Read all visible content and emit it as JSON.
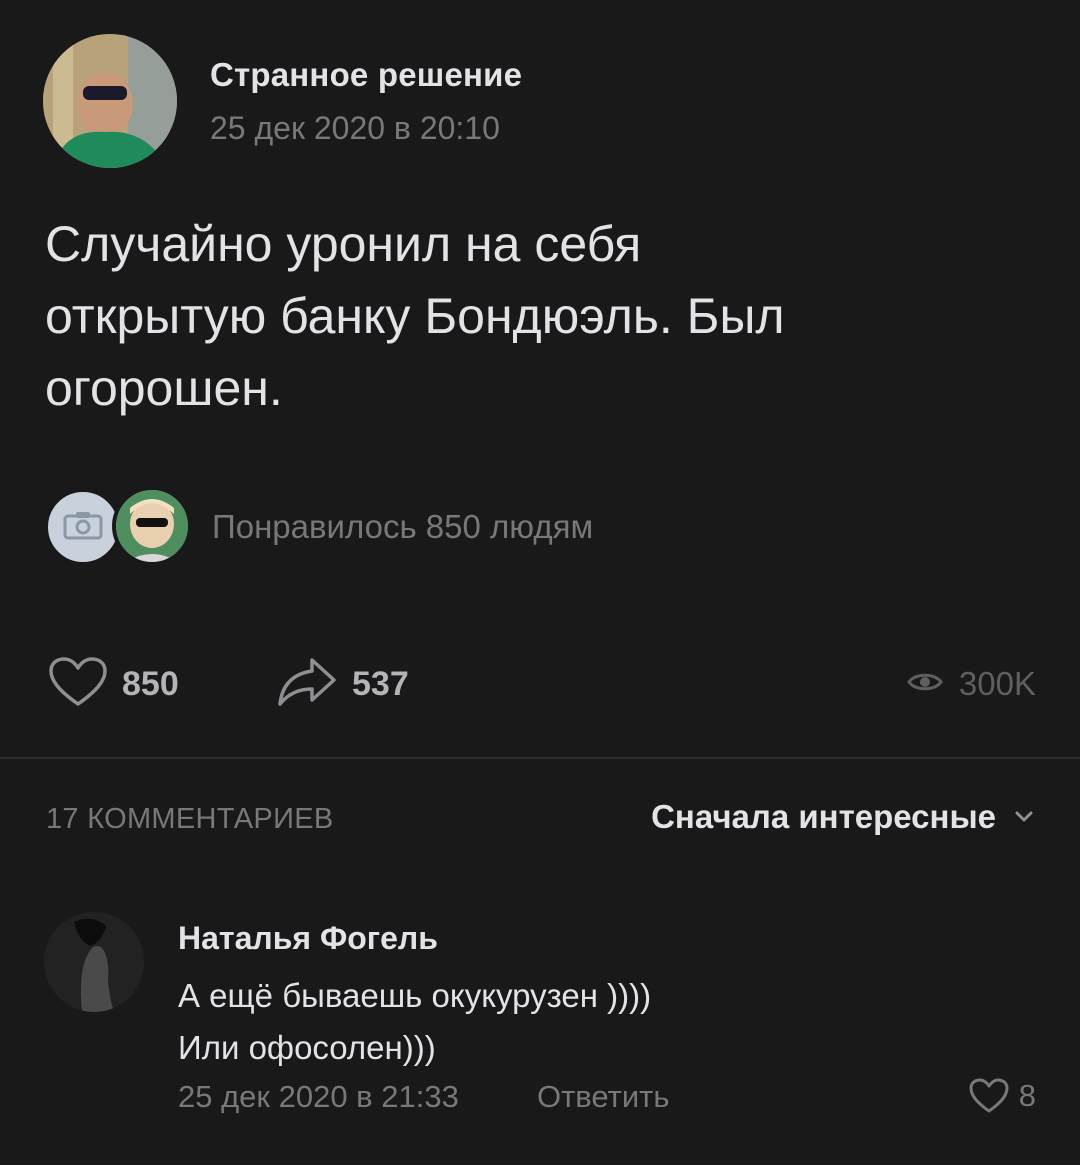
{
  "post": {
    "author": "Странное решение",
    "date": "25 дек 2020 в 20:10",
    "text": "Случайно уронил на себя\nоткрытую банку Бондюэль. Был\nогорошен.",
    "liked_text": "Понравилось 850 людям",
    "likes": "850",
    "shares": "537",
    "views": "300K"
  },
  "comments": {
    "count_label": "17 КОММЕНТАРИЕВ",
    "sort_label": "Сначала интересные",
    "items": [
      {
        "author": "Наталья Фогель",
        "text": "А ещё бываешь окукурузен ))))\nИли офосолен)))",
        "date": "25 дек 2020 в 21:33",
        "reply_label": "Ответить",
        "likes": "8"
      }
    ]
  },
  "icons": {
    "like": "heart-outline-icon",
    "share": "share-arrow-icon",
    "views": "eye-icon",
    "sort": "chevron-down-icon",
    "camera": "camera-icon"
  },
  "colors": {
    "background": "#19191a",
    "text_primary": "#e1e3e6",
    "text_secondary": "#76787a",
    "divider": "#2c2d2e"
  }
}
